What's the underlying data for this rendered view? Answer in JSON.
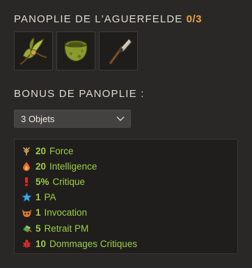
{
  "set": {
    "title": "PANOPLIE DE L'AGUERFELDE",
    "count": "0/3",
    "items": [
      {
        "icon": "feathered-amulet-icon"
      },
      {
        "icon": "green-belt-bag-icon"
      },
      {
        "icon": "wand-icon"
      }
    ]
  },
  "bonus": {
    "title": "BONUS DE PANOPLIE :",
    "selected": "3 Objets",
    "rows": [
      {
        "value": "20",
        "label": "Force",
        "icon": "force-icon"
      },
      {
        "value": "20",
        "label": "Intelligence",
        "icon": "intelligence-icon"
      },
      {
        "value": "5%",
        "label": "Critique",
        "icon": "critical-icon"
      },
      {
        "value": "1",
        "label": "PA",
        "icon": "ap-star-icon"
      },
      {
        "value": "1",
        "label": "Invocation",
        "icon": "summon-icon"
      },
      {
        "value": "5",
        "label": "Retrait PM",
        "icon": "mp-removal-icon"
      },
      {
        "value": "10",
        "label": "Dommages Critiques",
        "icon": "critical-damage-icon"
      }
    ]
  },
  "colors": {
    "accent_count": "#e8a33d",
    "bonus_text": "#9ecc45"
  }
}
